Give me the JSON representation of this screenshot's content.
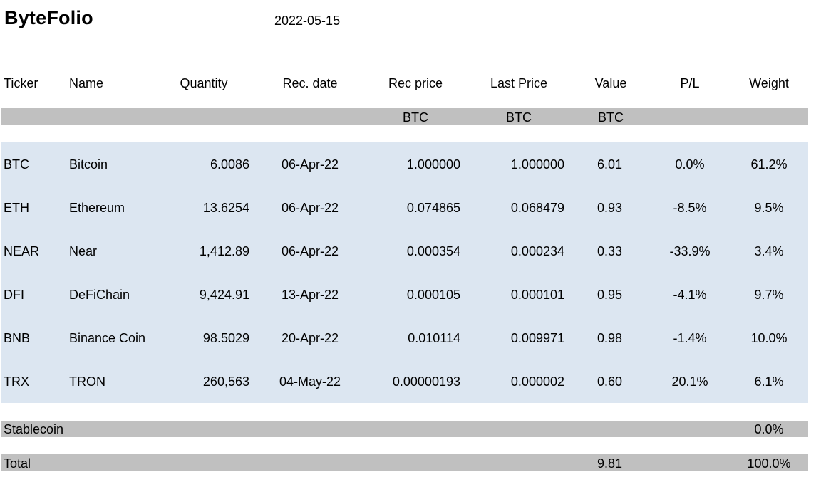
{
  "app": {
    "title": "ByteFolio",
    "date": "2022-05-15"
  },
  "table": {
    "headers": {
      "ticker": "Ticker",
      "name": "Name",
      "quantity": "Quantity",
      "rec_date": "Rec. date",
      "rec_price": "Rec price",
      "last_price": "Last Price",
      "value": "Value",
      "pl": "P/L",
      "weight": "Weight"
    },
    "units": {
      "rec_price": "BTC",
      "last_price": "BTC",
      "value": "BTC"
    },
    "rows": [
      {
        "ticker": "BTC",
        "name": "Bitcoin",
        "quantity": "6.0086",
        "rec_date": "06-Apr-22",
        "rec_price": "1.000000",
        "last_price": "1.000000",
        "value": "6.01",
        "pl": "0.0%",
        "weight": "61.2%"
      },
      {
        "ticker": "ETH",
        "name": "Ethereum",
        "quantity": "13.6254",
        "rec_date": "06-Apr-22",
        "rec_price": "0.074865",
        "last_price": "0.068479",
        "value": "0.93",
        "pl": "-8.5%",
        "weight": "9.5%"
      },
      {
        "ticker": "NEAR",
        "name": "Near",
        "quantity": "1,412.89",
        "rec_date": "06-Apr-22",
        "rec_price": "0.000354",
        "last_price": "0.000234",
        "value": "0.33",
        "pl": "-33.9%",
        "weight": "3.4%"
      },
      {
        "ticker": "DFI",
        "name": "DeFiChain",
        "quantity": "9,424.91",
        "rec_date": "13-Apr-22",
        "rec_price": "0.000105",
        "last_price": "0.000101",
        "value": "0.95",
        "pl": "-4.1%",
        "weight": "9.7%"
      },
      {
        "ticker": "BNB",
        "name": "Binance Coin",
        "quantity": "98.5029",
        "rec_date": "20-Apr-22",
        "rec_price": "0.010114",
        "last_price": "0.009971",
        "value": "0.98",
        "pl": "-1.4%",
        "weight": "10.0%"
      },
      {
        "ticker": "TRX",
        "name": "TRON",
        "quantity": "260,563",
        "rec_date": "04-May-22",
        "rec_price": "0.00000193",
        "last_price": "0.000002",
        "value": "0.60",
        "pl": "20.1%",
        "weight": "6.1%"
      }
    ],
    "stablecoin": {
      "label": "Stablecoin",
      "weight": "0.0%"
    },
    "total": {
      "label": "Total",
      "value": "9.81",
      "weight": "100.0%"
    }
  },
  "colors": {
    "band_gray": "#c0c0c0",
    "band_blue": "#dce6f1"
  }
}
